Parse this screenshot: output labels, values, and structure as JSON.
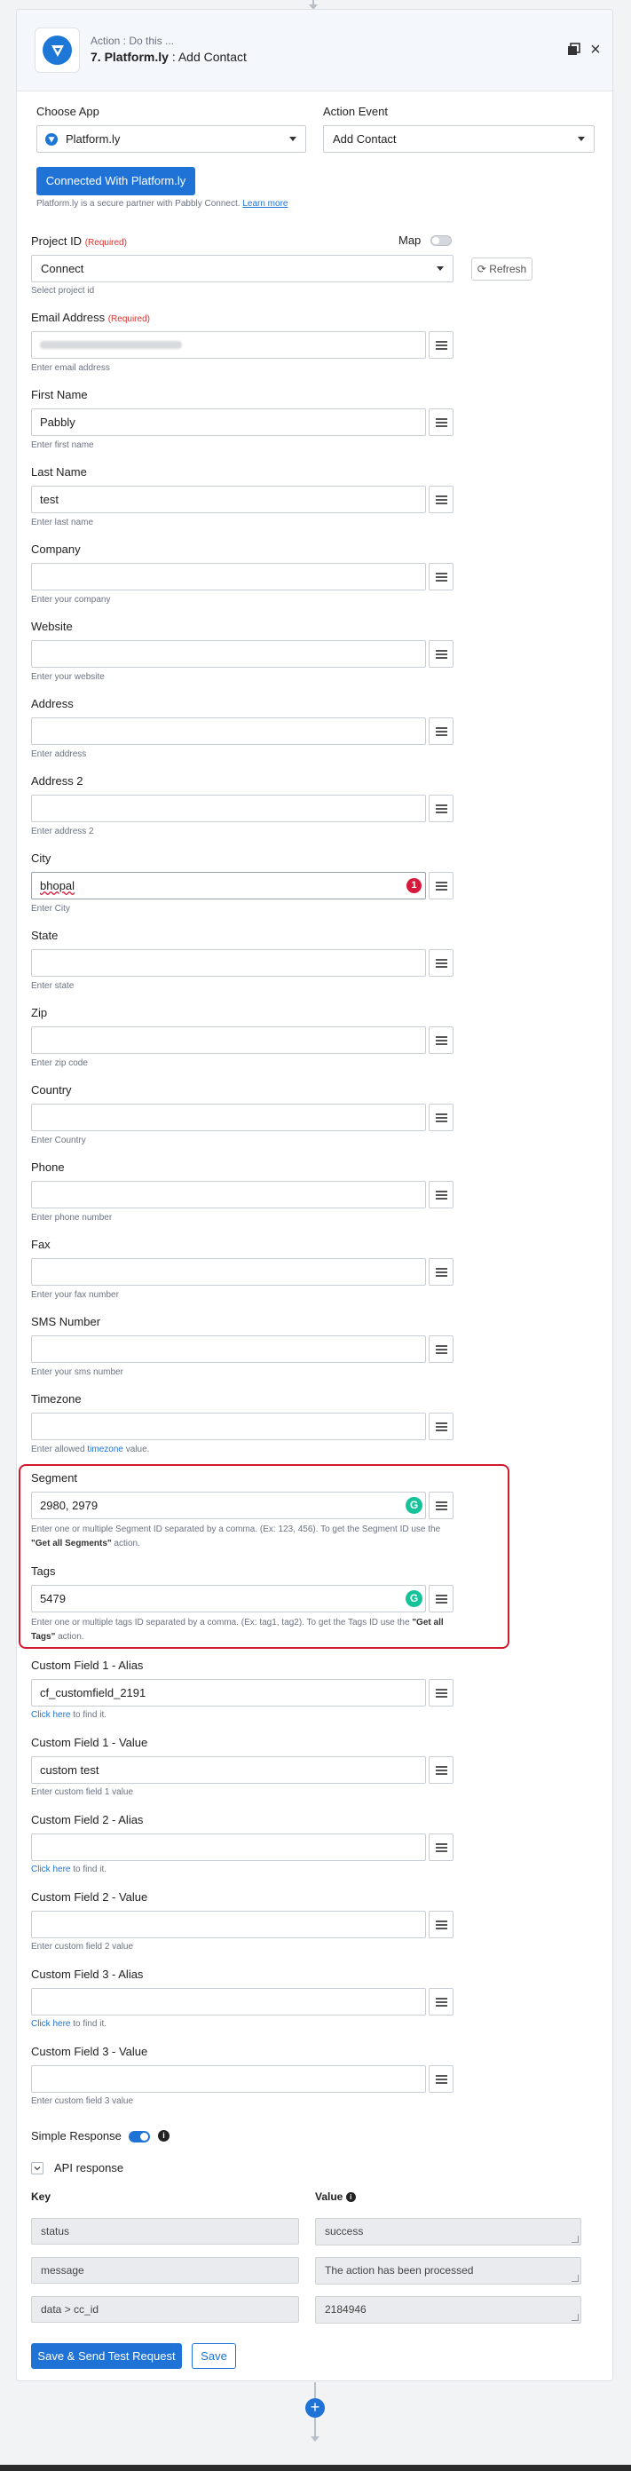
{
  "header": {
    "subtitle": "Action : Do this ...",
    "step": "7. Platform.ly",
    "action_name": ": Add Contact"
  },
  "choose_app": {
    "label": "Choose App",
    "value": "Platform.ly"
  },
  "action_event": {
    "label": "Action Event",
    "value": "Add Contact"
  },
  "connected_button": "Connected With Platform.ly",
  "partner_note": {
    "text": "Platform.ly is a secure partner with Pabbly Connect.",
    "link": "Learn more"
  },
  "project": {
    "label": "Project ID",
    "required": "(Required)",
    "map_label": "Map",
    "value": "Connect",
    "refresh": "Refresh",
    "hint": "Select project id"
  },
  "fields": [
    {
      "key": "email",
      "label": "Email Address",
      "required": "(Required)",
      "value": "",
      "hint": "Enter email address"
    },
    {
      "key": "first_name",
      "label": "First Name",
      "value": "Pabbly",
      "hint": "Enter first name"
    },
    {
      "key": "last_name",
      "label": "Last Name",
      "value": "test",
      "hint": "Enter last name"
    },
    {
      "key": "company",
      "label": "Company",
      "value": "",
      "hint": "Enter your company"
    },
    {
      "key": "website",
      "label": "Website",
      "value": "",
      "hint": "Enter your website"
    },
    {
      "key": "address",
      "label": "Address",
      "value": "",
      "hint": "Enter address"
    },
    {
      "key": "address2",
      "label": "Address 2",
      "value": "",
      "hint": "Enter address 2"
    },
    {
      "key": "city",
      "label": "City",
      "value": "bhopal",
      "hint": "Enter City",
      "badge": "1"
    },
    {
      "key": "state",
      "label": "State",
      "value": "",
      "hint": "Enter state"
    },
    {
      "key": "zip",
      "label": "Zip",
      "value": "",
      "hint": "Enter zip code"
    },
    {
      "key": "country",
      "label": "Country",
      "value": "",
      "hint": "Enter Country"
    },
    {
      "key": "phone",
      "label": "Phone",
      "value": "",
      "hint": "Enter phone number"
    },
    {
      "key": "fax",
      "label": "Fax",
      "value": "",
      "hint": "Enter your fax number"
    },
    {
      "key": "sms",
      "label": "SMS Number",
      "value": "",
      "hint": "Enter your sms number"
    },
    {
      "key": "timezone",
      "label": "Timezone",
      "value": "",
      "hint_pre": "Enter allowed",
      "hint_link": "timezone",
      "hint_post": "value."
    },
    {
      "key": "segment",
      "label": "Segment",
      "value": "2980, 2979",
      "hint_pre": "Enter one or multiple Segment ID separated by a comma. (Ex: 123, 456). To get the Segment ID use the",
      "hint_bold": "\"Get all Segments\"",
      "hint_post": "action."
    },
    {
      "key": "tags",
      "label": "Tags",
      "value": "5479",
      "hint_pre": "Enter one or multiple tags ID separated by a comma. (Ex: tag1, tag2). To get the Tags ID use the",
      "hint_bold": "\"Get all Tags\"",
      "hint_post": "action."
    },
    {
      "key": "cf1_alias",
      "label": "Custom Field 1 - Alias",
      "value": "cf_customfield_2191",
      "hint_link": "Click here",
      "hint_post": "to find it."
    },
    {
      "key": "cf1_value",
      "label": "Custom Field 1 - Value",
      "value": "custom test",
      "hint": "Enter custom field 1 value"
    },
    {
      "key": "cf2_alias",
      "label": "Custom Field 2 - Alias",
      "value": "",
      "hint_link": "Click here",
      "hint_post": "to find it."
    },
    {
      "key": "cf2_value",
      "label": "Custom Field 2 - Value",
      "value": "",
      "hint": "Enter custom field 2 value"
    },
    {
      "key": "cf3_alias",
      "label": "Custom Field 3 - Alias",
      "value": "",
      "hint_link": "Click here",
      "hint_post": "to find it."
    },
    {
      "key": "cf3_value",
      "label": "Custom Field 3 - Value",
      "value": "",
      "hint": "Enter custom field 3 value"
    }
  ],
  "simple_response": {
    "label": "Simple Response",
    "enabled": true
  },
  "api_response": {
    "label": "API response",
    "key_header": "Key",
    "value_header": "Value",
    "rows": [
      {
        "key": "status",
        "value": "success"
      },
      {
        "key": "message",
        "value": "The action has been processed"
      },
      {
        "key": "data > cc_id",
        "value": "2184946"
      }
    ]
  },
  "buttons": {
    "save_test": "Save & Send Test Request",
    "save": "Save"
  },
  "colors": {
    "primary": "#1f73d7",
    "highlight": "#d3192d",
    "required": "#d9332f",
    "grammarly": "#15c39a"
  }
}
